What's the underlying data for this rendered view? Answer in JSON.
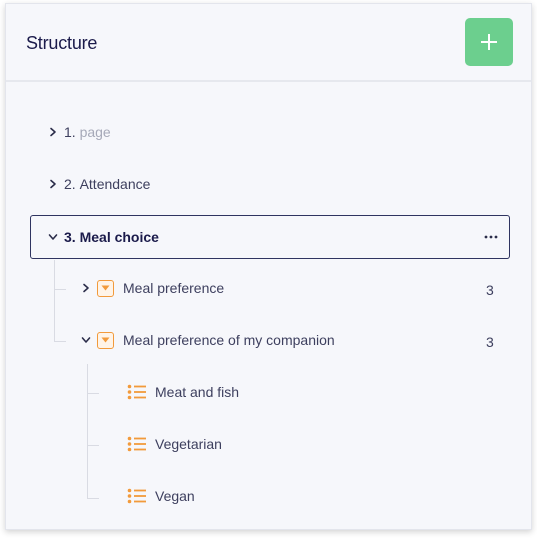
{
  "header": {
    "title": "Structure",
    "add_button": "plus-icon"
  },
  "colors": {
    "accent_green": "#6ccf8e",
    "question_icon_orange": "#f29a3b",
    "selected_border": "#2f3460"
  },
  "tree": {
    "pages": [
      {
        "number": "1.",
        "label": "page",
        "expanded": false
      },
      {
        "number": "2.",
        "label": "Attendance",
        "expanded": false
      },
      {
        "number": "3.",
        "label": "Meal choice",
        "expanded": true,
        "selected": true,
        "menu_icon": "more-horizontal-icon"
      }
    ],
    "questions": [
      {
        "label": "Meal preference",
        "count": "3",
        "expanded": false,
        "icon": "dropdown-question-icon"
      },
      {
        "label": "Meal preference of my companion",
        "count": "3",
        "expanded": true,
        "icon": "dropdown-question-icon"
      }
    ],
    "options": [
      {
        "label": "Meat and fish",
        "icon": "list-icon"
      },
      {
        "label": "Vegetarian",
        "icon": "list-icon"
      },
      {
        "label": "Vegan",
        "icon": "list-icon"
      }
    ]
  }
}
